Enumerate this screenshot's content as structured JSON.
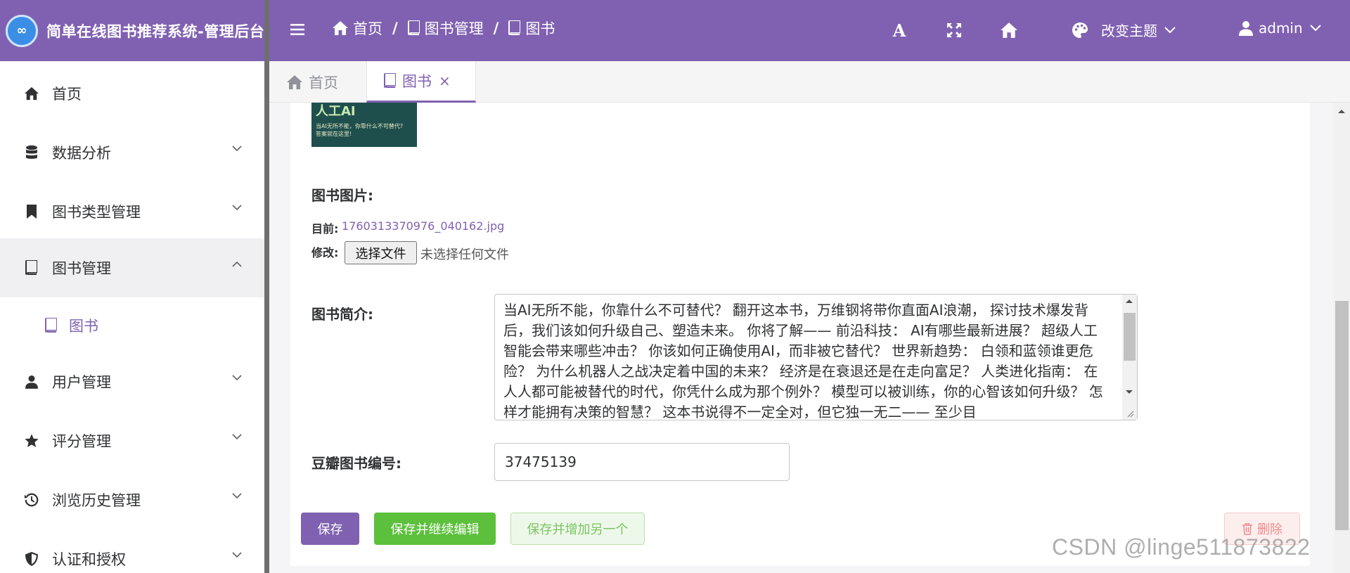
{
  "app": {
    "logo_text": "∞",
    "title": "简单在线图书推荐系统-管理后台"
  },
  "header": {
    "breadcrumbs": [
      {
        "label": "首页",
        "icon": "home-icon"
      },
      {
        "label": "图书管理",
        "icon": "book-icon"
      },
      {
        "label": "图书",
        "icon": "book-icon"
      }
    ],
    "separator": "/",
    "font_icon_label": "A",
    "theme_label": "改变主题",
    "user_label": "admin",
    "accent_color": "#8061b1"
  },
  "sidebar": {
    "items": [
      {
        "label": "首页",
        "icon": "home-icon",
        "expandable": false
      },
      {
        "label": "数据分析",
        "icon": "database-icon",
        "expandable": true,
        "chevron": "down"
      },
      {
        "label": "图书类型管理",
        "icon": "bookmark-icon",
        "expandable": true,
        "chevron": "down"
      },
      {
        "label": "图书管理",
        "icon": "book-icon",
        "expandable": true,
        "chevron": "up",
        "open": true
      },
      {
        "label": "用户管理",
        "icon": "user-icon",
        "expandable": true,
        "chevron": "down"
      },
      {
        "label": "评分管理",
        "icon": "star-icon",
        "expandable": true,
        "chevron": "down"
      },
      {
        "label": "浏览历史管理",
        "icon": "history-icon",
        "expandable": true,
        "chevron": "down"
      },
      {
        "label": "认证和授权",
        "icon": "shield-icon",
        "expandable": true,
        "chevron": "down"
      }
    ],
    "submenu": {
      "label": "图书",
      "icon": "book-icon"
    }
  },
  "tabs": [
    {
      "label": "首页",
      "icon": "home-icon",
      "active": false
    },
    {
      "label": "图书",
      "icon": "book-icon",
      "active": true,
      "close": "×"
    }
  ],
  "form": {
    "cover_text": {
      "big": "人工AI",
      "line1": "当AI无所不能，你靠什么不可替代?",
      "line2": "答案就在这里!"
    },
    "image_field": {
      "label": "图书图片:",
      "current_label": "目前:",
      "current_file": "1760313370976_040162.jpg",
      "change_label": "修改:",
      "choose_button": "选择文件",
      "no_file_text": "未选择任何文件"
    },
    "description_field": {
      "label": "图书简介:",
      "value": "当AI无所不能，你靠什么不可替代？ 翻开这本书，万维钢将带你直面AI浪潮， 探讨技术爆发背后，我们该如何升级自己、塑造未来。 你将了解—— 前沿科技： AI有哪些最新进展？ 超级人工智能会带来哪些冲击？ 你该如何正确使用AI，而非被它替代？ 世界新趋势： 白领和蓝领谁更危险？ 为什么机器人之战决定着中国的未来？ 经济是在衰退还是在走向富足？ 人类进化指南： 在人人都可能被替代的时代，你凭什么成为那个例外？ 模型可以被训练，你的心智该如何升级？ 怎样才能拥有决策的智慧？ 这本书说得不一定全对，但它独一无二—— 至少目"
    },
    "douban_field": {
      "label": "豆瓣图书编号:",
      "value": "37475139"
    }
  },
  "actions": {
    "save": "保存",
    "save_continue": "保存并继续编辑",
    "save_add_another": "保存并增加另一个",
    "delete": "删除"
  },
  "watermark": "CSDN @linge511873822"
}
